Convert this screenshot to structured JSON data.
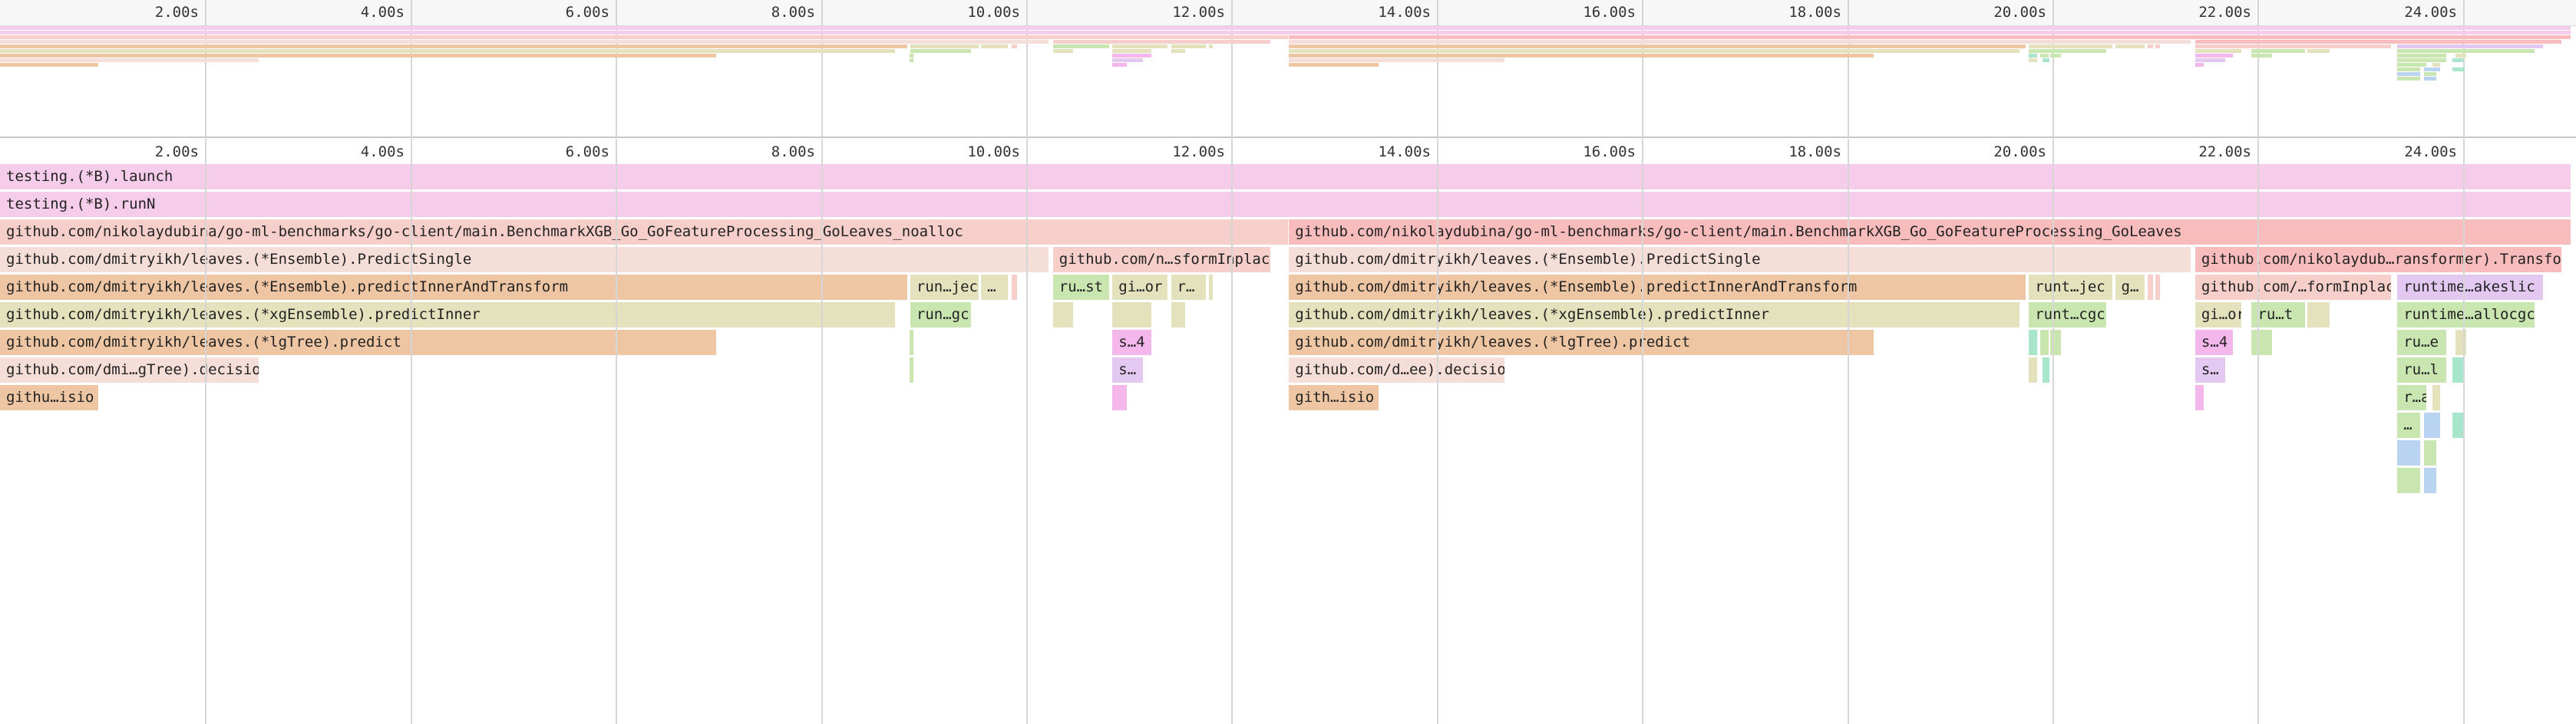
{
  "view": {
    "x_min": 0,
    "x_max": 25.1,
    "ticks": [
      "2.00s",
      "4.00s",
      "6.00s",
      "8.00s",
      "10.00s",
      "12.00s",
      "14.00s",
      "16.00s",
      "18.00s",
      "20.00s",
      "22.00s",
      "24.00s"
    ],
    "tick_values": [
      2,
      4,
      6,
      8,
      10,
      12,
      14,
      16,
      18,
      20,
      22,
      24
    ]
  },
  "colors": {
    "pink": "#f5cce9",
    "salmon": "#f6cfcb",
    "light_rose": "#f5ddd8",
    "orange": "#efc6a3",
    "olive": "#e3e2bd",
    "green": "#c9e6b1",
    "magenta": "#f3b7ec",
    "lavender": "#e3c9f2",
    "blue": "#b8d4f0",
    "teal": "#a8e6cc",
    "red": "#f9bcbc"
  },
  "frames": [
    {
      "depth": 0,
      "start": 0,
      "end": 25.05,
      "label": "testing.(*B).launch",
      "color": "pink"
    },
    {
      "depth": 1,
      "start": 0,
      "end": 25.05,
      "label": "testing.(*B).runN",
      "color": "pink"
    },
    {
      "depth": 2,
      "start": 0,
      "end": 12.55,
      "label": "github.com/nikolaydubina/go-ml-benchmarks/go-client/main.BenchmarkXGB_Go_GoFeatureProcessing_GoLeaves_noalloc",
      "color": "salmon"
    },
    {
      "depth": 2,
      "start": 12.56,
      "end": 25.05,
      "label": "github.com/nikolaydubina/go-ml-benchmarks/go-client/main.BenchmarkXGB_Go_GoFeatureProcessing_GoLeaves",
      "color": "red"
    },
    {
      "depth": 3,
      "start": 0,
      "end": 10.22,
      "label": "github.com/dmitryikh/leaves.(*Ensemble).PredictSingle",
      "color": "light_rose"
    },
    {
      "depth": 3,
      "start": 10.26,
      "end": 12.38,
      "label": "github.com/n…sformInplac",
      "color": "salmon"
    },
    {
      "depth": 3,
      "start": 12.56,
      "end": 21.35,
      "label": "github.com/dmitryikh/leaves.(*Ensemble).PredictSingle",
      "color": "light_rose"
    },
    {
      "depth": 3,
      "start": 21.39,
      "end": 24.96,
      "label": "github.com/nikolaydub…ransformer).Transfor",
      "color": "red"
    },
    {
      "depth": 4,
      "start": 0,
      "end": 8.84,
      "label": "github.com/dmitryikh/leaves.(*Ensemble).predictInnerAndTransform",
      "color": "orange"
    },
    {
      "depth": 4,
      "start": 8.87,
      "end": 9.54,
      "label": "run…jec",
      "color": "olive"
    },
    {
      "depth": 4,
      "start": 9.56,
      "end": 9.82,
      "label": "…",
      "color": "olive"
    },
    {
      "depth": 4,
      "start": 9.86,
      "end": 9.91,
      "label": "",
      "color": "salmon"
    },
    {
      "depth": 4,
      "start": 10.26,
      "end": 10.81,
      "label": "ru…st",
      "color": "green"
    },
    {
      "depth": 4,
      "start": 10.84,
      "end": 11.38,
      "label": "gi…or",
      "color": "olive"
    },
    {
      "depth": 4,
      "start": 11.41,
      "end": 11.75,
      "label": "r…",
      "color": "olive"
    },
    {
      "depth": 4,
      "start": 11.78,
      "end": 11.82,
      "label": "",
      "color": "olive"
    },
    {
      "depth": 4,
      "start": 12.56,
      "end": 19.74,
      "label": "github.com/dmitryikh/leaves.(*Ensemble).predictInnerAndTransform",
      "color": "orange"
    },
    {
      "depth": 4,
      "start": 19.77,
      "end": 20.58,
      "label": "runt…jec",
      "color": "olive"
    },
    {
      "depth": 4,
      "start": 20.61,
      "end": 20.9,
      "label": "g…",
      "color": "olive"
    },
    {
      "depth": 4,
      "start": 20.93,
      "end": 20.98,
      "label": "",
      "color": "salmon"
    },
    {
      "depth": 4,
      "start": 21.0,
      "end": 21.05,
      "label": "",
      "color": "salmon"
    },
    {
      "depth": 4,
      "start": 21.39,
      "end": 23.3,
      "label": "github.com/…formInplac",
      "color": "salmon"
    },
    {
      "depth": 4,
      "start": 23.36,
      "end": 24.78,
      "label": "runtime…akeslic",
      "color": "lavender"
    },
    {
      "depth": 5,
      "start": 0,
      "end": 8.72,
      "label": "github.com/dmitryikh/leaves.(*xgEnsemble).predictInner",
      "color": "olive"
    },
    {
      "depth": 5,
      "start": 8.87,
      "end": 9.46,
      "label": "run…gc",
      "color": "green"
    },
    {
      "depth": 5,
      "start": 8.65,
      "end": 8.69,
      "label": "",
      "color": "olive"
    },
    {
      "depth": 5,
      "start": 10.26,
      "end": 10.46,
      "label": "",
      "color": "olive"
    },
    {
      "depth": 5,
      "start": 10.84,
      "end": 11.22,
      "label": "",
      "color": "olive"
    },
    {
      "depth": 5,
      "start": 11.41,
      "end": 11.55,
      "label": "",
      "color": "olive"
    },
    {
      "depth": 5,
      "start": 12.56,
      "end": 19.68,
      "label": "github.com/dmitryikh/leaves.(*xgEnsemble).predictInner",
      "color": "olive"
    },
    {
      "depth": 5,
      "start": 19.77,
      "end": 20.52,
      "label": "runt…cgc",
      "color": "green"
    },
    {
      "depth": 5,
      "start": 21.39,
      "end": 21.84,
      "label": "gi…or",
      "color": "olive"
    },
    {
      "depth": 5,
      "start": 21.94,
      "end": 22.46,
      "label": "ru…t",
      "color": "green"
    },
    {
      "depth": 5,
      "start": 22.48,
      "end": 22.7,
      "label": "",
      "color": "olive"
    },
    {
      "depth": 5,
      "start": 23.36,
      "end": 24.7,
      "label": "runtime…allocgc",
      "color": "green"
    },
    {
      "depth": 6,
      "start": 0,
      "end": 6.98,
      "label": "github.com/dmitryikh/leaves.(*lgTree).predict",
      "color": "orange"
    },
    {
      "depth": 6,
      "start": 8.86,
      "end": 8.9,
      "label": "",
      "color": "green"
    },
    {
      "depth": 6,
      "start": 10.84,
      "end": 11.22,
      "label": "s…4",
      "color": "magenta"
    },
    {
      "depth": 6,
      "start": 12.56,
      "end": 18.26,
      "label": "github.com/dmitryikh/leaves.(*lgTree).predict",
      "color": "orange"
    },
    {
      "depth": 6,
      "start": 19.77,
      "end": 19.85,
      "label": "",
      "color": "teal"
    },
    {
      "depth": 6,
      "start": 19.88,
      "end": 19.96,
      "label": "",
      "color": "green"
    },
    {
      "depth": 6,
      "start": 19.98,
      "end": 20.08,
      "label": "",
      "color": "green"
    },
    {
      "depth": 6,
      "start": 21.39,
      "end": 21.76,
      "label": "s…4",
      "color": "magenta"
    },
    {
      "depth": 6,
      "start": 21.94,
      "end": 22.14,
      "label": "",
      "color": "green"
    },
    {
      "depth": 6,
      "start": 23.36,
      "end": 23.84,
      "label": "ru…e",
      "color": "green"
    },
    {
      "depth": 6,
      "start": 23.93,
      "end": 24.03,
      "label": "",
      "color": "olive"
    },
    {
      "depth": 7,
      "start": 0,
      "end": 2.52,
      "label": "github.com/dmi…gTree).decisio",
      "color": "light_rose"
    },
    {
      "depth": 7,
      "start": 8.86,
      "end": 8.9,
      "label": "",
      "color": "green"
    },
    {
      "depth": 7,
      "start": 10.84,
      "end": 11.14,
      "label": "s…",
      "color": "lavender"
    },
    {
      "depth": 7,
      "start": 12.56,
      "end": 14.66,
      "label": "github.com/d…ee).decisio",
      "color": "light_rose"
    },
    {
      "depth": 7,
      "start": 19.77,
      "end": 19.85,
      "label": "",
      "color": "olive"
    },
    {
      "depth": 7,
      "start": 19.9,
      "end": 19.97,
      "label": "",
      "color": "teal"
    },
    {
      "depth": 7,
      "start": 21.39,
      "end": 21.68,
      "label": "s…",
      "color": "lavender"
    },
    {
      "depth": 7,
      "start": 23.36,
      "end": 23.84,
      "label": "ru…l",
      "color": "green"
    },
    {
      "depth": 7,
      "start": 23.9,
      "end": 24.0,
      "label": "",
      "color": "teal"
    },
    {
      "depth": 8,
      "start": 0,
      "end": 0.96,
      "label": "githu…isio",
      "color": "orange"
    },
    {
      "depth": 8,
      "start": 10.84,
      "end": 10.98,
      "label": "",
      "color": "magenta"
    },
    {
      "depth": 8,
      "start": 12.56,
      "end": 13.43,
      "label": "gith…isio",
      "color": "orange"
    },
    {
      "depth": 8,
      "start": 21.39,
      "end": 21.47,
      "label": "",
      "color": "magenta"
    },
    {
      "depth": 8,
      "start": 23.36,
      "end": 23.64,
      "label": "r…a",
      "color": "green"
    },
    {
      "depth": 8,
      "start": 23.7,
      "end": 23.78,
      "label": "",
      "color": "olive"
    },
    {
      "depth": 9,
      "start": 23.36,
      "end": 23.58,
      "label": "…",
      "color": "green"
    },
    {
      "depth": 9,
      "start": 23.62,
      "end": 23.78,
      "label": "",
      "color": "blue"
    },
    {
      "depth": 9,
      "start": 23.9,
      "end": 24.02,
      "label": "",
      "color": "teal"
    },
    {
      "depth": 10,
      "start": 23.36,
      "end": 23.58,
      "label": "",
      "color": "blue"
    },
    {
      "depth": 10,
      "start": 23.62,
      "end": 23.74,
      "label": "",
      "color": "green"
    },
    {
      "depth": 11,
      "start": 23.36,
      "end": 23.58,
      "label": "",
      "color": "green"
    },
    {
      "depth": 11,
      "start": 23.62,
      "end": 23.74,
      "label": "",
      "color": "blue"
    }
  ]
}
